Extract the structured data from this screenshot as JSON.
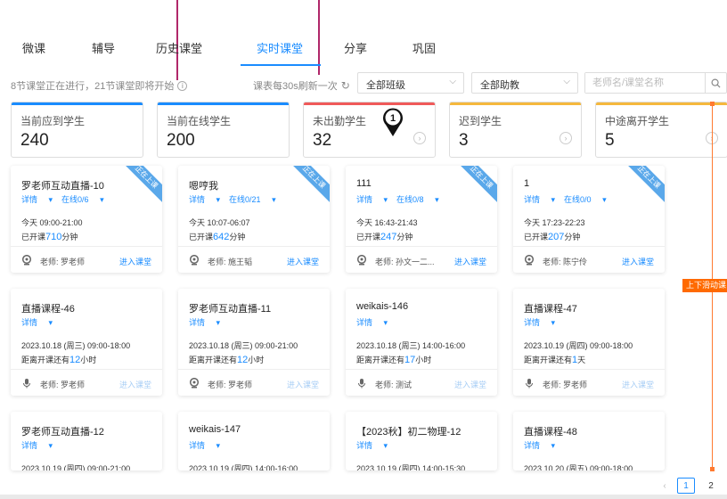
{
  "tabs": [
    {
      "label": "微课"
    },
    {
      "label": "辅导"
    },
    {
      "label": "历史课堂"
    },
    {
      "label": "实时课堂"
    },
    {
      "label": "分享"
    },
    {
      "label": "巩固"
    }
  ],
  "status_text": "8节课堂正在进行，21节课堂即将开始",
  "refresh_text": "课表每30s刷新一次",
  "filters": {
    "class_select": "全部班级",
    "assistant_select": "全部助教",
    "search_placeholder": "老师名/课堂名称"
  },
  "stats": [
    {
      "label": "当前应到学生",
      "value": "240",
      "color": "#1a8cff"
    },
    {
      "label": "当前在线学生",
      "value": "200",
      "color": "#1a8cff"
    },
    {
      "label": "未出勤学生",
      "value": "32",
      "color": "#f05a5a"
    },
    {
      "label": "迟到学生",
      "value": "3",
      "color": "#f5b83d"
    },
    {
      "label": "中途离开学生",
      "value": "5",
      "color": "#f5b83d"
    }
  ],
  "marker_label": "1",
  "live_ribbon": "正在上课",
  "detail_label": "详情",
  "enter_label": "进入课堂",
  "cards": [
    {
      "title": "罗老师互动直播-10",
      "online": "在线0/6",
      "time": "今天 09:00-21:00",
      "dur_prefix": "已开课",
      "dur_num": "710",
      "dur_suffix": "分钟",
      "teacher": "老师: 罗老师"
    },
    {
      "title": "嗯哼我",
      "online": "在线0/21",
      "time": "今天 10:07-06:07",
      "dur_prefix": "已开课",
      "dur_num": "642",
      "dur_suffix": "分钟",
      "teacher": "老师: 施王韬"
    },
    {
      "title": "111",
      "online": "在线0/8",
      "time": "今天 16:43-21:43",
      "dur_prefix": "已开课",
      "dur_num": "247",
      "dur_suffix": "分钟",
      "teacher": "老师: 孙文一二..."
    },
    {
      "title": "1",
      "online": "在线0/0",
      "time": "今天 17:23-22:23",
      "dur_prefix": "已开课",
      "dur_num": "207",
      "dur_suffix": "分钟",
      "teacher": "老师: 陈宁伶"
    },
    {
      "title": "直播课程-46",
      "time": "2023.10.18 (周三) 09:00-18:00",
      "dur_prefix": "距离开课还有",
      "dur_num": "12",
      "dur_suffix": "小时",
      "teacher": "老师: 罗老师"
    },
    {
      "title": "罗老师互动直播-11",
      "time": "2023.10.18 (周三) 09:00-21:00",
      "dur_prefix": "距离开课还有",
      "dur_num": "12",
      "dur_suffix": "小时",
      "teacher": "老师: 罗老师"
    },
    {
      "title": "weikais-146",
      "time": "2023.10.18 (周三) 14:00-16:00",
      "dur_prefix": "距离开课还有",
      "dur_num": "17",
      "dur_suffix": "小时",
      "teacher": "老师: 测试"
    },
    {
      "title": "直播课程-47",
      "time": "2023.10.19 (周四) 09:00-18:00",
      "dur_prefix": "距离开课还有",
      "dur_num": "1",
      "dur_suffix": "天",
      "teacher": "老师: 罗老师"
    },
    {
      "title": "罗老师互动直播-12",
      "time": "2023.10.19 (周四) 09:00-21:00"
    },
    {
      "title": "weikais-147",
      "time": "2023.10.19 (周四) 14:00-16:00"
    },
    {
      "title": "【2023秋】初二物理-12",
      "time": "2023.10.19 (周四) 14:00-15:30"
    },
    {
      "title": "直播课程-48",
      "time": "2023.10.20 (周五) 09:00-18:00"
    }
  ],
  "side_label": "上下滑动课",
  "pagination": {
    "prev": "‹",
    "pages": [
      "1",
      "2"
    ]
  }
}
